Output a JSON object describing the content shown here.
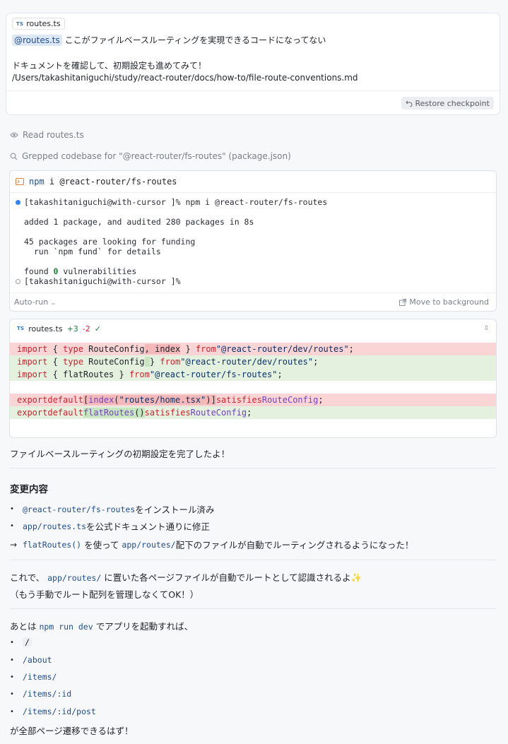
{
  "user_message": {
    "file_chip": {
      "badge": "TS",
      "name": "routes.ts"
    },
    "mention": "@routes.ts",
    "line1": "ここがファイルベースルーティングを実現できるコードになってない",
    "line2": "ドキュメントを確認して、初期設定も進めてみて！",
    "line3": "/Users/takashitaniguchi/study/react-router/docs/how-to/file-route-conventions.md",
    "restore_label": "Restore checkpoint"
  },
  "activities": [
    {
      "icon": "eye-icon",
      "text": "Read routes.ts"
    },
    {
      "icon": "search-icon",
      "text": "Grepped codebase for \"@react-router/fs-routes\" (package.json)"
    }
  ],
  "terminal": {
    "cmd_npm": "npm",
    "cmd_rest": " i @react-router/fs-routes",
    "prompt1": "[takashitaniguchi@with-cursor ]% npm i @react-router/fs-routes",
    "out1": "added 1 package, and audited 280 packages in 8s",
    "out2": "45 packages are looking for funding",
    "out3": "  run `npm fund` for details",
    "out4_pre": "found ",
    "out4_num": "0",
    "out4_post": " vulnerabilities",
    "prompt2": "[takashitaniguchi@with-cursor ]%",
    "auto_run": "Auto-run",
    "move_bg": "Move to background"
  },
  "diff": {
    "badge": "TS",
    "file": "routes.ts",
    "added": "+3",
    "removed": "-2",
    "check": "✓"
  },
  "response": {
    "intro": "ファイルベースルーティングの初期設定を完了したよ！",
    "heading": "変更内容",
    "b1_code": "@react-router/fs-routes",
    "b1_text": " をインストール済み",
    "b2_code": "app/routes.ts",
    "b2_text": " を公式ドキュメント通りに修正",
    "arrow": "→",
    "b3_code1": "flatRoutes()",
    "b3_text1": " を使って ",
    "b3_code2": "app/routes/",
    "b3_text2": " 配下のファイルが自動でルーティングされるようになった！",
    "p1_pre": "これで、 ",
    "p1_code": "app/routes/",
    "p1_post": " に置いた各ページファイルが自動でルートとして認識されるよ✨",
    "p2": "（もう手動でルート配列を管理しなくてOK！）",
    "p3_pre": "あとは ",
    "p3_code": "npm run dev",
    "p3_post": " でアプリを起動すれば、",
    "routes": [
      "/",
      "/about",
      "/items/",
      "/items/:id",
      "/items/:id/post"
    ],
    "closing": "が全部ページ遷移できるはず！"
  }
}
